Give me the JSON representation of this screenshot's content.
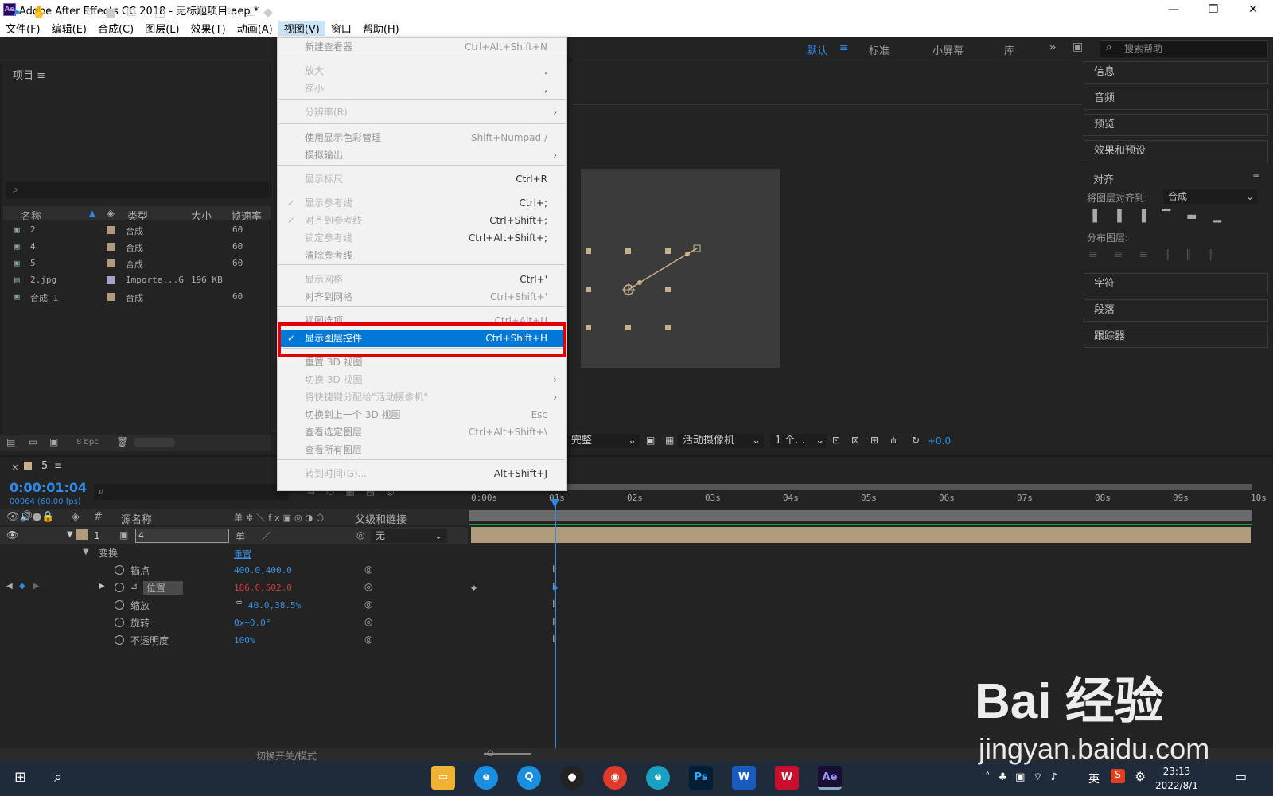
{
  "window": {
    "title": "Adobe After Effects CC 2018 - 无标题项目.aep *",
    "app_icon": "Ae",
    "minimize": "—",
    "maximize": "❐",
    "close": "✕"
  },
  "menubar": [
    "文件(F)",
    "编辑(E)",
    "合成(C)",
    "图层(L)",
    "效果(T)",
    "动画(A)",
    "视图(V)",
    "窗口",
    "帮助(H)"
  ],
  "workspaces": {
    "default": "默认",
    "standard": "标准",
    "small": "小屏幕",
    "library": "库",
    "more": "»"
  },
  "search_help": {
    "placeholder": "搜索帮助"
  },
  "project": {
    "title": "项目",
    "columns": [
      "名称",
      "类型",
      "大小",
      "帧速率"
    ],
    "rows": [
      {
        "name": "2",
        "type": "合成",
        "size": "",
        "fps": "60",
        "color": "#b09c7c"
      },
      {
        "name": "4",
        "type": "合成",
        "size": "",
        "fps": "60",
        "color": "#b09c7c"
      },
      {
        "name": "5",
        "type": "合成",
        "size": "",
        "fps": "60",
        "color": "#b09c7c"
      },
      {
        "name": "2.jpg",
        "type": "Importe...G",
        "size": "196 KB",
        "fps": "",
        "color": "#a8a0c8"
      },
      {
        "name": "合成 1",
        "type": "合成",
        "size": "",
        "fps": "60",
        "color": "#b09c7c"
      }
    ],
    "bpc": "8 bpc"
  },
  "viewer": {
    "quality": "完整",
    "camera": "活动摄像机",
    "views": "1 个...",
    "exposure": "+0.0"
  },
  "right_panels": [
    "信息",
    "音频",
    "预览",
    "效果和预设"
  ],
  "align": {
    "title": "对齐",
    "align_to_label": "将图层对齐到:",
    "align_to_value": "合成",
    "distribute_label": "分布图层:"
  },
  "right_panels_lower": [
    "字符",
    "段落",
    "跟踪器"
  ],
  "timeline": {
    "comp_name": "5",
    "timecode": "0:00:01:04",
    "frames": "00064 (60.00 fps)",
    "col_headers": {
      "source": "源名称",
      "parent": "父级和链接",
      "num": "#"
    },
    "layer": {
      "num": "1",
      "name": "4",
      "parent": "无"
    },
    "transform_label": "变换",
    "reset": "重置",
    "props": [
      {
        "name": "锚点",
        "value": "400.0,400.0",
        "color": "#3a8fe0"
      },
      {
        "name": "位置",
        "value": "186.0,502.0",
        "color": "#d03a3a"
      },
      {
        "name": "缩放",
        "value": "40.0,38.5%",
        "color": "#3a8fe0"
      },
      {
        "name": "旋转",
        "value": "0x+0.0°",
        "color": "#3a8fe0"
      },
      {
        "name": "不透明度",
        "value": "100%",
        "color": "#3a8fe0"
      }
    ],
    "ruler": [
      "0:00s",
      "01s",
      "02s",
      "03s",
      "04s",
      "05s",
      "06s",
      "07s",
      "08s",
      "09s",
      "10s"
    ],
    "toggle_label": "切换开关/模式"
  },
  "view_menu": {
    "items": [
      {
        "label": "新建查看器",
        "shortcut": "Ctrl+Alt+Shift+N",
        "disabled": true
      },
      {
        "label": "放大",
        "shortcut": "."
      },
      {
        "label": "缩小",
        "shortcut": ","
      },
      {
        "label": "分辨率(R)",
        "submenu": "›"
      },
      {
        "label": "使用显示色彩管理",
        "shortcut": "Shift+Numpad /",
        "disabled": true
      },
      {
        "label": "模拟输出",
        "submenu": "›",
        "disabled": true
      },
      {
        "label": "显示标尺",
        "shortcut": "Ctrl+R"
      },
      {
        "label": "显示参考线",
        "shortcut": "Ctrl+;",
        "checked": "✓"
      },
      {
        "label": "对齐到参考线",
        "shortcut": "Ctrl+Shift+;",
        "checked": "✓"
      },
      {
        "label": "锁定参考线",
        "shortcut": "Ctrl+Alt+Shift+;"
      },
      {
        "label": "清除参考线",
        "shortcut": "",
        "disabled": true
      },
      {
        "label": "显示网格",
        "shortcut": "Ctrl+'"
      },
      {
        "label": "对齐到网格",
        "shortcut": "Ctrl+Shift+'",
        "disabled": true
      },
      {
        "label": "视图选项...",
        "shortcut": "Ctrl+Alt+U",
        "disabled": true
      },
      {
        "label": "显示图层控件",
        "shortcut": "Ctrl+Shift+H",
        "checked": "✓",
        "highlighted": true
      },
      {
        "label": "重置 3D 视图",
        "shortcut": "",
        "disabled": true
      },
      {
        "label": "切换 3D 视图",
        "submenu": "›"
      },
      {
        "label": "将快捷键分配给\"活动摄像机\"",
        "submenu": "›"
      },
      {
        "label": "切换到上一个 3D 视图",
        "shortcut": "Esc",
        "disabled": true
      },
      {
        "label": "查看选定图层",
        "shortcut": "Ctrl+Alt+Shift+\\",
        "disabled": true
      },
      {
        "label": "查看所有图层",
        "shortcut": "",
        "disabled": true
      },
      {
        "label": "转到时间(G)...",
        "shortcut": "Alt+Shift+J"
      }
    ]
  },
  "taskbar": {
    "time": "23:13",
    "date": "2022/8/1",
    "lang": "英",
    "apps": [
      "Ps",
      "W",
      "Ae"
    ]
  },
  "watermark": {
    "main": "Bai 经验",
    "sub": "jingyan.baidu.com"
  }
}
